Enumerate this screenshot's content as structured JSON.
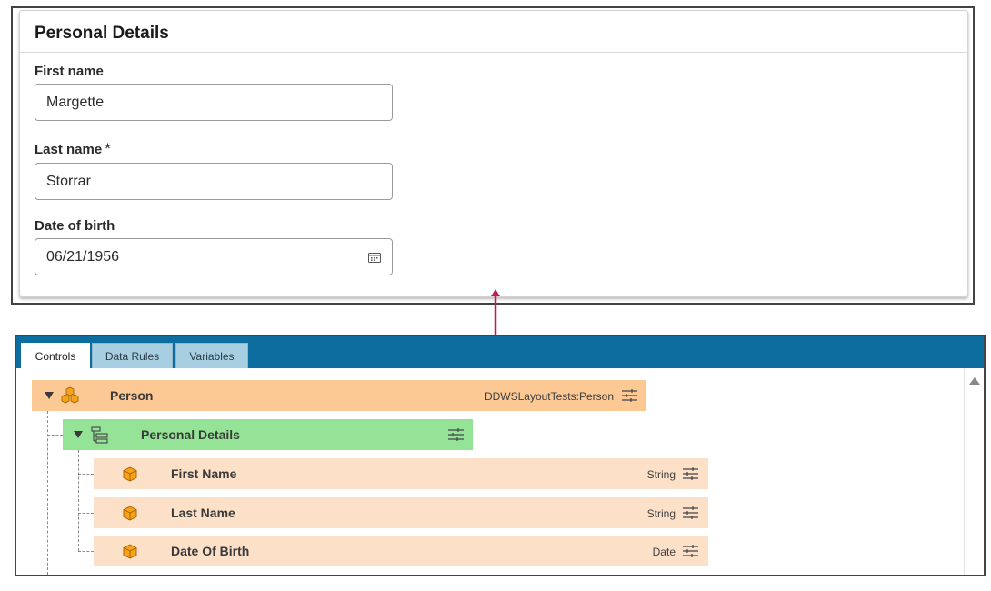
{
  "form": {
    "title": "Personal Details",
    "fields": [
      {
        "label": "First name",
        "value": "Margette",
        "required": false
      },
      {
        "label": "Last name",
        "value": "Storrar",
        "required": true,
        "required_mark": "*"
      },
      {
        "label": "Date of birth",
        "value": "06/21/1956",
        "required": false,
        "icon": "calendar-icon"
      }
    ]
  },
  "designer": {
    "tabs": [
      {
        "label": "Controls",
        "active": true
      },
      {
        "label": "Data Rules",
        "active": false
      },
      {
        "label": "Variables",
        "active": false
      }
    ],
    "tree": {
      "root": {
        "label": "Person",
        "type": "DDWSLayoutTests:Person",
        "icon": "entity-cubes-icon",
        "color": "#fcc894",
        "expanded": true
      },
      "section": {
        "label": "Personal Details",
        "icon": "section-tree-icon",
        "color": "#94e397",
        "expanded": true
      },
      "items": [
        {
          "label": "First Name",
          "type": "String",
          "icon": "field-cube-icon"
        },
        {
          "label": "Last Name",
          "type": "String",
          "icon": "field-cube-icon"
        },
        {
          "label": "Date Of Birth",
          "type": "Date",
          "icon": "field-cube-icon"
        }
      ],
      "field_color": "#fce1c8"
    }
  },
  "colors": {
    "designer_header": "#0d6d9e",
    "connector_arrow": "#c2185b",
    "tab_inactive": "#a8cfe1"
  }
}
